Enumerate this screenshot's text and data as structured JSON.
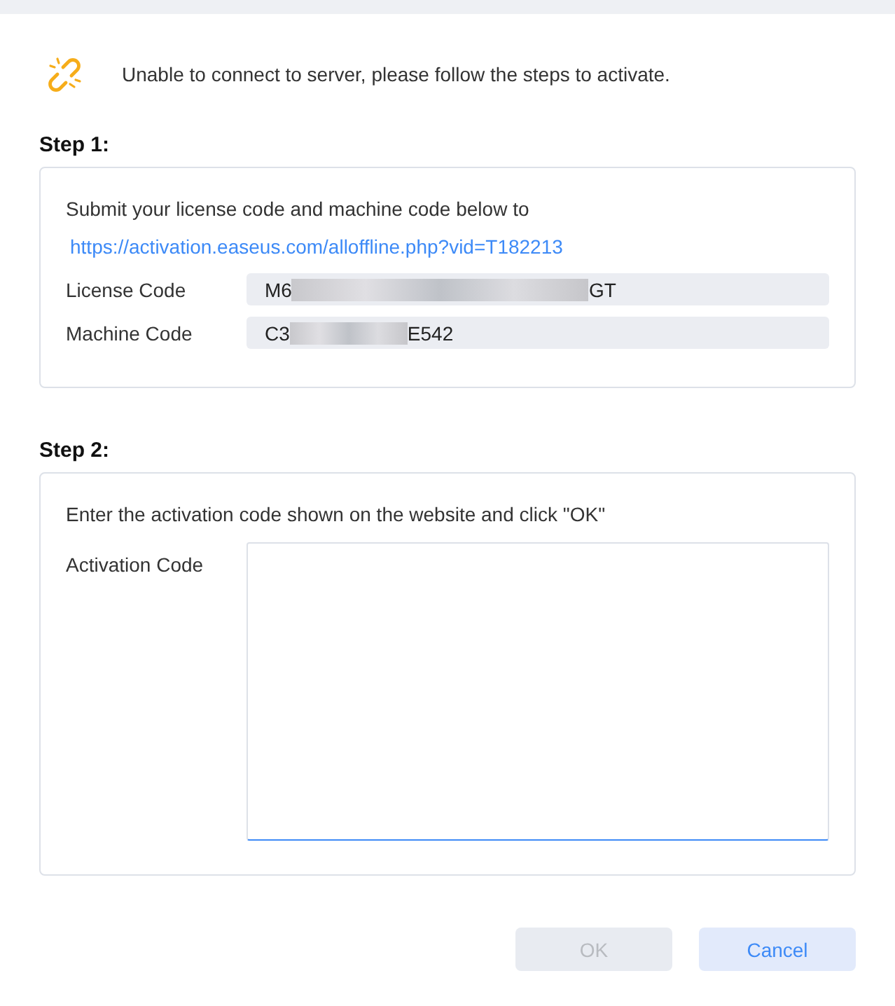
{
  "message": "Unable to connect to server, please follow the steps to activate.",
  "step1": {
    "title": "Step 1:",
    "instruction": "Submit your license code and machine code below to",
    "link": "https://activation.easeus.com/alloffline.php?vid=T182213",
    "fields": [
      {
        "label": "License Code",
        "value_start": "M6",
        "value_end": "GT",
        "redacted": true
      },
      {
        "label": "Machine Code",
        "value_start": "C3",
        "value_end": "E542",
        "redacted": true
      }
    ]
  },
  "step2": {
    "title": "Step 2:",
    "instruction": "Enter the activation code shown on the website and click \"OK\"",
    "field": {
      "label": "Activation Code",
      "focused": true
    }
  },
  "buttons": [
    {
      "label": "OK",
      "kind": "primary",
      "disabled": true
    },
    {
      "label": "Cancel",
      "kind": "secondary",
      "disabled": false
    }
  ]
}
